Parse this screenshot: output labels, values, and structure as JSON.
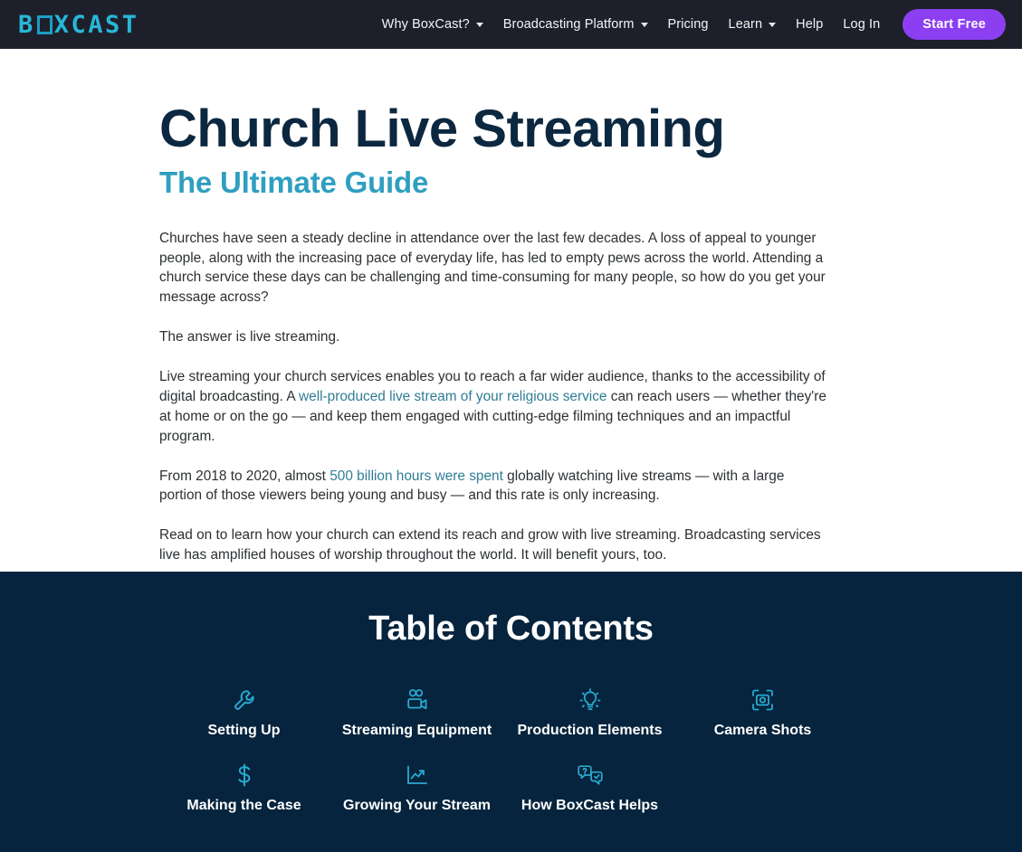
{
  "header": {
    "logo": {
      "pre": "B",
      "o": "O",
      "post": "XCAST",
      "full": "BOXCAST",
      "color": "#29b6d8"
    },
    "nav": [
      {
        "label": "Why BoxCast?",
        "has_dropdown": true,
        "name": "why-boxcast"
      },
      {
        "label": "Broadcasting Platform",
        "has_dropdown": true,
        "name": "broadcasting-platform"
      },
      {
        "label": "Pricing",
        "has_dropdown": false,
        "name": "pricing"
      },
      {
        "label": "Learn",
        "has_dropdown": true,
        "name": "learn"
      },
      {
        "label": "Help",
        "has_dropdown": false,
        "name": "help"
      },
      {
        "label": "Log In",
        "has_dropdown": false,
        "name": "log-in"
      }
    ],
    "cta_label": "Start Free",
    "cta_color": "#8b3ff0",
    "background": "#1d202b"
  },
  "article": {
    "title": "Church Live Streaming",
    "subtitle": "The Ultimate Guide",
    "title_color": "#0c2840",
    "subtitle_color": "#2f9fc0",
    "link_color": "#2f7d95",
    "paragraphs": {
      "p1": "Churches have seen a steady decline in attendance over the last few decades. A loss of appeal to younger people, along with the increasing pace of everyday life, has led to empty pews across the world. Attending a church service these days can be challenging and time-consuming for many people, so how do you get your message across?",
      "p2": "The answer is live streaming.",
      "p3_a": "Live streaming your church services enables you to reach a far wider audience, thanks to the accessibility of digital broadcasting. A ",
      "p3_link": "well-produced live stream of your religious service",
      "p3_b": " can reach users — whether they're at home or on the go — and keep them engaged with cutting-edge filming techniques and an impactful program.",
      "p4_a": "From 2018 to 2020, almost ",
      "p4_link": "500 billion hours were spent",
      "p4_b": " globally watching live streams — with a large portion of those viewers being young and busy — and this rate is only increasing.",
      "p5": "Read on to learn how your church can extend its reach and grow with live streaming. Broadcasting services live has amplified houses of worship throughout the world. It will benefit yours, too."
    }
  },
  "toc": {
    "title": "Table of Contents",
    "background": "#06243d",
    "icon_color": "#2aa9cf",
    "items": [
      {
        "label": "Setting Up",
        "icon": "wrench-icon"
      },
      {
        "label": "Streaming Equipment",
        "icon": "video-camera-icon"
      },
      {
        "label": "Production Elements",
        "icon": "lightbulb-icon"
      },
      {
        "label": "Camera Shots",
        "icon": "camera-focus-icon"
      },
      {
        "label": "Making the Case",
        "icon": "dollar-sign-icon"
      },
      {
        "label": "Growing Your Stream",
        "icon": "line-chart-icon"
      },
      {
        "label": "How BoxCast Helps",
        "icon": "chat-bubbles-icon"
      }
    ]
  }
}
